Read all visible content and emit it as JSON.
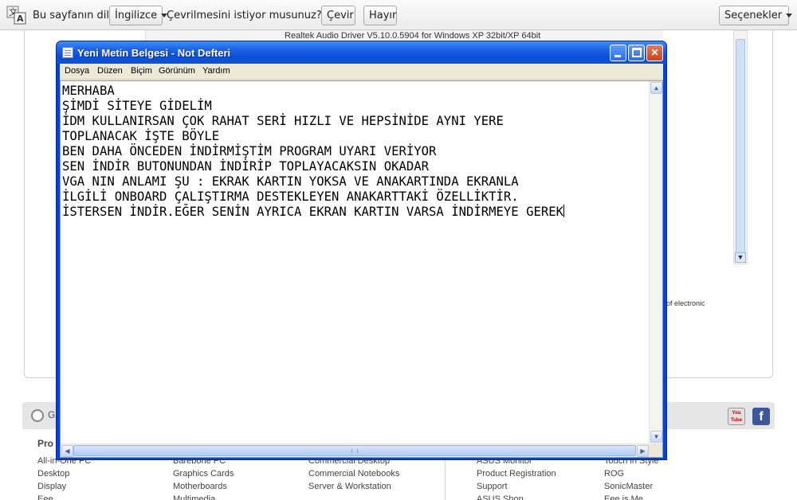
{
  "translate_bar": {
    "prefix": "Bu sayfanın dili",
    "language": "İngilizce",
    "question": "Çevrilmesini istiyor musunuz?",
    "translate_button": "Çevir",
    "no_button": "Hayır",
    "options_button": "Seçenekler"
  },
  "page": {
    "driver_row": "Realtek Audio Driver V5.10.0.5904 for Windows XP 32bit/XP 64bit",
    "electronic_text": "of electronic",
    "footer_g": "G",
    "footer_heading": "Pro",
    "youtube_label": "You Tube",
    "facebook_label": "f",
    "footer_columns": [
      [
        "All-in-One PC",
        "Desktop",
        "Display",
        "Eee"
      ],
      [
        "Barebone PC",
        "Graphics Cards",
        "Motherboards",
        "Multimedia"
      ],
      [
        "Commercial Desktop",
        "Commercial Notebooks",
        "Server & Workstation"
      ],
      [
        "ASUS Monitor",
        "Product Registration",
        "Support",
        "ASUS Shop"
      ],
      [
        "Touch in Style",
        "ROG",
        "SonicMaster",
        "Eee is Me"
      ]
    ]
  },
  "notepad": {
    "title": "Yeni Metin Belgesi - Not Defteri",
    "menu": [
      "Dosya",
      "Düzen",
      "Biçim",
      "Görünüm",
      "Yardım"
    ],
    "lines": [
      "MERHABA",
      "ŞİMDİ SİTEYE GİDELİM",
      "İDM KULLANIRSAN ÇOK RAHAT SERİ HIZLI VE HEPSİNİDE AYNI YERE",
      "TOPLANACAK İŞTE BÖYLE",
      "BEN DAHA ÖNCEDEN İNDİRMİŞTİM PROGRAM UYARI VERİYOR",
      "SEN İNDİR BUTONUNDAN İNDİRİP TOPLAYACAKSIN OKADAR",
      "VGA NIN ANLAMI ŞU : EKRAK KARTIN YOKSA VE ANAKARTINDA EKRANLA",
      "İLGİLİ ONBOARD ÇALIŞTIRMA DESTEKLEYEN ANAKARTTAKİ ÖZELLİKTİR.",
      "İSTERSEN İNDİR.EĞER SENİN AYRICA EKRAN KARTIN VARSA İNDİRMEYE GEREK"
    ]
  }
}
